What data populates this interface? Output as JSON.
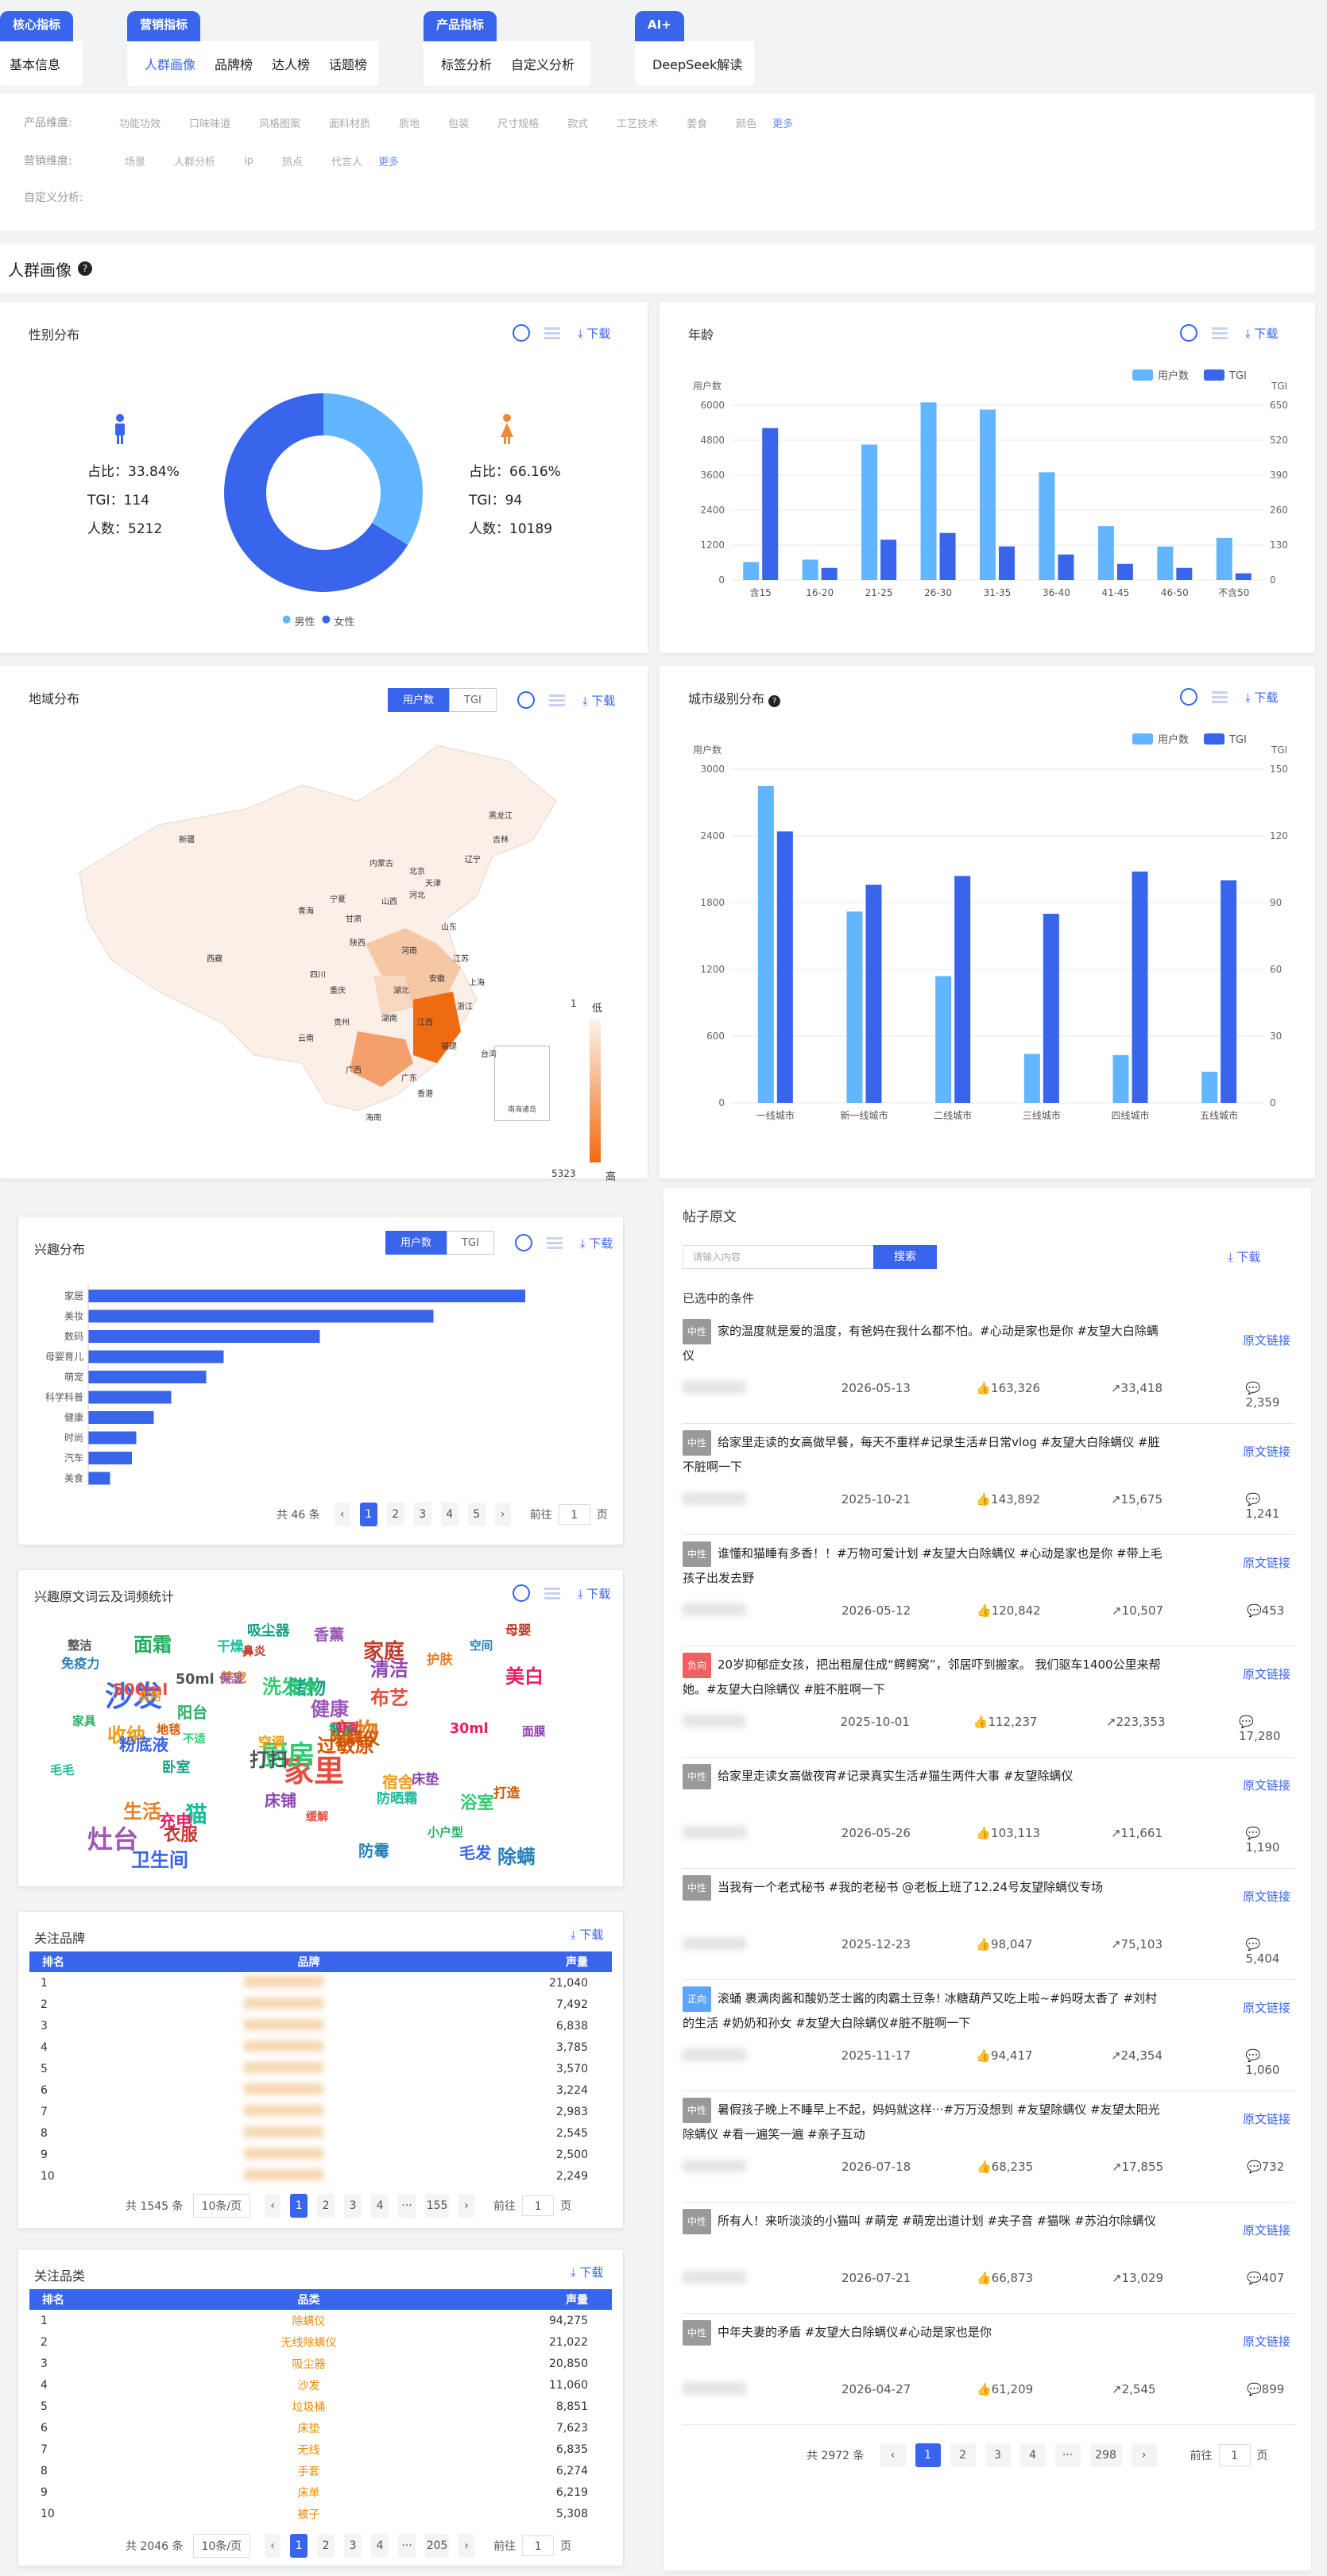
{
  "nav": {
    "groups": [
      {
        "title": "核心指标",
        "items": [
          "基本信息"
        ]
      },
      {
        "title": "营销指标",
        "items": [
          "人群画像",
          "品牌榜",
          "达人榜",
          "话题榜"
        ]
      },
      {
        "title": "产品指标",
        "items": [
          "标签分析",
          "自定义分析"
        ]
      },
      {
        "title": "AI+",
        "items": [
          "DeepSeek解读"
        ]
      }
    ]
  },
  "filters": {
    "product_label": "产品维度:",
    "product_items": [
      "功能功效",
      "口味味道",
      "风格图案",
      "面料材质",
      "质地",
      "包装",
      "尺寸规格",
      "款式",
      "工艺技术",
      "姜食",
      "颜色"
    ],
    "marketing_label": "营销维度:",
    "marketing_items": [
      "场景",
      "人群分析",
      "ip",
      "热点",
      "代言人"
    ],
    "custom_label": "自定义分析:",
    "more": "更多"
  },
  "section_title": "人群画像",
  "download": "下载",
  "gender": {
    "title": "性别分布",
    "male": {
      "ratio": "占比：33.84%",
      "tgi": "TGI：114",
      "count": "人数：5212"
    },
    "female": {
      "ratio": "占比：66.16%",
      "tgi": "TGI：94",
      "count": "人数：10189"
    },
    "legend": [
      "男性",
      "女性"
    ],
    "colors": [
      "#62b6ff",
      "#3964ec"
    ]
  },
  "age": {
    "title": "年龄",
    "legend": [
      "用户数",
      "TGI"
    ],
    "left_unit": "用户数",
    "right_unit": "TGI"
  },
  "region": {
    "title": "地域分布",
    "seg": [
      "用户数",
      "TGI"
    ],
    "legend_high": "低",
    "legend_low": "高",
    "legend_min": "1",
    "legend_max": "5323",
    "inset": "南海诸岛",
    "provinces": [
      "新疆",
      "西藏",
      "青海",
      "甘肃",
      "内蒙古",
      "黑龙江",
      "吉林",
      "辽宁",
      "北京",
      "天津",
      "河北",
      "山西",
      "陕西",
      "宁夏",
      "四川",
      "重庆",
      "云南",
      "贵州",
      "广西",
      "湖南",
      "湖北",
      "河南",
      "山东",
      "江苏",
      "安徽",
      "上海",
      "浙江",
      "福建",
      "江西",
      "广东",
      "海南",
      "台湾",
      "香港"
    ]
  },
  "city": {
    "title": "城市级别分布",
    "legend": [
      "用户数",
      "TGI"
    ],
    "left_unit": "用户数",
    "right_unit": "TGI"
  },
  "chart_data": [
    {
      "type": "pie",
      "title": "性别分布",
      "categories": [
        "男性",
        "女性"
      ],
      "values": [
        33.84,
        66.16
      ]
    },
    {
      "type": "bar",
      "title": "年龄",
      "categories": [
        "含15",
        "16-20",
        "21-25",
        "26-30",
        "31-35",
        "36-40",
        "41-45",
        "46-50",
        "不含50"
      ],
      "series": [
        {
          "name": "用户数",
          "values": [
            620,
            700,
            4650,
            6100,
            5850,
            3700,
            1850,
            1150,
            1450
          ]
        },
        {
          "name": "TGI",
          "values": [
            565,
            45,
            150,
            175,
            125,
            95,
            60,
            45,
            25
          ]
        }
      ],
      "ylim": [
        0,
        6000
      ],
      "y2lim": [
        0,
        650
      ],
      "yticks": [
        "0",
        "1200",
        "2400",
        "3600",
        "4800",
        "6000"
      ],
      "y2ticks": [
        "0",
        "130",
        "260",
        "390",
        "520",
        "650"
      ]
    },
    {
      "type": "bar",
      "title": "城市级别分布",
      "categories": [
        "一线城市",
        "新一线城市",
        "二线城市",
        "三线城市",
        "四线城市",
        "五线城市"
      ],
      "series": [
        {
          "name": "用户数",
          "values": [
            2850,
            1720,
            1140,
            440,
            430,
            280
          ]
        },
        {
          "name": "TGI",
          "values": [
            122,
            98,
            102,
            85,
            104,
            100
          ]
        }
      ],
      "ylim": [
        0,
        3000
      ],
      "y2lim": [
        0,
        150
      ],
      "yticks": [
        "0",
        "600",
        "1200",
        "1800",
        "2400",
        "3000"
      ],
      "y2ticks": [
        "0",
        "30",
        "60",
        "90",
        "120",
        "150"
      ]
    },
    {
      "type": "bar",
      "title": "兴趣分布",
      "categories": [
        "家居",
        "美妆",
        "数码",
        "母婴育儿",
        "萌宠",
        "科学科普",
        "健康",
        "时尚",
        "汽车",
        "美食"
      ],
      "values": [
        100,
        79,
        53,
        31,
        27,
        19,
        15,
        11,
        10,
        5
      ]
    }
  ],
  "interest": {
    "title": "兴趣分布",
    "seg": [
      "用户数",
      "TGI"
    ],
    "total": "共 46 条",
    "pages": [
      "1",
      "2",
      "3",
      "4",
      "5"
    ],
    "goto": "前往",
    "goto_val": "1",
    "page_unit": "页"
  },
  "wordcloud": {
    "title": "兴趣原文词云及词频统计",
    "words": [
      "家里",
      "沙发",
      "厨房",
      "灶台",
      "宠物",
      "猫",
      "家庭",
      "储物",
      "清洁",
      "过敏原",
      "面霜",
      "除螨",
      "收纳",
      "美白",
      "打扫",
      "布艺",
      "卫生间",
      "洗发水",
      "健康",
      "生活",
      "干燥",
      "衣服",
      "卧室",
      "床垫",
      "地毯",
      "家具",
      "防霉",
      "空调",
      "30ml",
      "50ml",
      "500ml",
      "毛发",
      "浴室",
      "香薰",
      "养宠",
      "防晒霜",
      "母婴",
      "智能",
      "面膜",
      "除螨仪",
      "小户型",
      "免疫力",
      "宿舍",
      "充电",
      "整洁",
      "缓解",
      "粉底液",
      "不适",
      "保湿",
      "护肤",
      "毛毛",
      "鼻炎",
      "吸尘器",
      "床铺",
      "打造",
      "阳台",
      "空间",
      "实用",
      "舒适"
    ]
  },
  "brands": {
    "title": "关注品牌",
    "headers": [
      "排名",
      "品牌",
      "声量"
    ],
    "rows": [
      [
        "1",
        "21,040"
      ],
      [
        "2",
        "7,492"
      ],
      [
        "3",
        "6,838"
      ],
      [
        "4",
        "3,785"
      ],
      [
        "5",
        "3,570"
      ],
      [
        "6",
        "3,224"
      ],
      [
        "7",
        "2,983"
      ],
      [
        "8",
        "2,545"
      ],
      [
        "9",
        "2,500"
      ],
      [
        "10",
        "2,249"
      ]
    ],
    "total": "共 1545 条",
    "page_size": "10条/页",
    "pages": [
      "1",
      "2",
      "3",
      "4",
      "···",
      "155"
    ],
    "goto": "前往",
    "goto_val": "1",
    "page_unit": "页"
  },
  "categories": {
    "title": "关注品类",
    "headers": [
      "排名",
      "品类",
      "声量"
    ],
    "rows": [
      [
        "1",
        "除螨仪",
        "94,275"
      ],
      [
        "2",
        "无线除螨仪",
        "21,022"
      ],
      [
        "3",
        "吸尘器",
        "20,850"
      ],
      [
        "4",
        "沙发",
        "11,060"
      ],
      [
        "5",
        "垃圾桶",
        "8,851"
      ],
      [
        "6",
        "床垫",
        "7,623"
      ],
      [
        "7",
        "无线",
        "6,835"
      ],
      [
        "8",
        "手套",
        "6,274"
      ],
      [
        "9",
        "床单",
        "6,219"
      ],
      [
        "10",
        "被子",
        "5,308"
      ]
    ],
    "total": "共 2046 条",
    "page_size": "10条/页",
    "pages": [
      "1",
      "2",
      "3",
      "4",
      "···",
      "205"
    ],
    "goto": "前往",
    "goto_val": "1",
    "page_unit": "页"
  },
  "posts": {
    "title": "帖子原文",
    "search_placeholder": "请输入内容",
    "search_btn": "搜索",
    "conditions": "已选中的条件",
    "link_label": "原文链接",
    "items": [
      {
        "tag": "中性",
        "text": "家的温度就是爱的温度，有爸妈在我什么都不怕。#心动是家也是你 #友望大白除螨仪",
        "date": "2026-05-13",
        "likes": "163,326",
        "shares": "33,418",
        "comments": "2,359"
      },
      {
        "tag": "中性",
        "text": "给家里走读的女高做早餐，每天不重样#记录生活#日常vlog #友望大白除螨仪 #脏不脏啊一下",
        "date": "2025-10-21",
        "likes": "143,892",
        "shares": "15,675",
        "comments": "1,241"
      },
      {
        "tag": "中性",
        "text": "谁懂和猫睡有多香！！#万物可爱计划 #友望大白除螨仪 #心动是家也是你 #带上毛孩子出发去野",
        "date": "2026-05-12",
        "likes": "120,842",
        "shares": "10,507",
        "comments": "453"
      },
      {
        "tag": "负向",
        "text": "20岁抑郁症女孩，把出租屋住成“鳄鳄窝”，邻居吓到搬家。 我们驱车1400公里来帮她。#友望大白除螨仪 #脏不脏啊一下",
        "date": "2025-10-01",
        "likes": "112,237",
        "shares": "223,353",
        "comments": "17,280"
      },
      {
        "tag": "中性",
        "text": "给家里走读女高做夜宵#记录真实生活#猫生两件大事 #友望除螨仪",
        "date": "2026-05-26",
        "likes": "103,113",
        "shares": "11,661",
        "comments": "1,190"
      },
      {
        "tag": "中性",
        "text": "当我有一个老式秘书 #我的老秘书 @老板上班了12.24号友望除螨仪专场",
        "date": "2025-12-23",
        "likes": "98,047",
        "shares": "75,103",
        "comments": "5,404"
      },
      {
        "tag": "正向",
        "text": "滚蛹 裹满肉酱和酸奶芝士酱的肉霸土豆条! 冰糖葫芦又吃上啦~#妈呀太香了 #刘村的生活 #奶奶和孙女 #友望大白除螨仪#脏不脏啊一下",
        "date": "2025-11-17",
        "likes": "94,417",
        "shares": "24,354",
        "comments": "1,060"
      },
      {
        "tag": "中性",
        "text": "暑假孩子晚上不睡早上不起，妈妈就这样···#万万没想到 #友望除螨仪 #友望太阳光除螨仪 #看一遍笑一遍 #亲子互动",
        "date": "2026-07-18",
        "likes": "68,235",
        "shares": "17,855",
        "comments": "732"
      },
      {
        "tag": "中性",
        "text": "所有人！来听淡淡的小猫叫 #萌宠 #萌宠出道计划 #夹子音 #猫咪 #苏泊尔除螨仪",
        "date": "2026-07-21",
        "likes": "66,873",
        "shares": "13,029",
        "comments": "407"
      },
      {
        "tag": "中性",
        "text": "中年夫妻的矛盾 #友望大白除螨仪#心动是家也是你",
        "date": "2026-04-27",
        "likes": "61,209",
        "shares": "2,545",
        "comments": "899"
      }
    ],
    "total": "共 2972 条",
    "pages": [
      "1",
      "2",
      "3",
      "4",
      "···",
      "298"
    ],
    "goto": "前往",
    "goto_val": "1",
    "page_unit": "页"
  }
}
